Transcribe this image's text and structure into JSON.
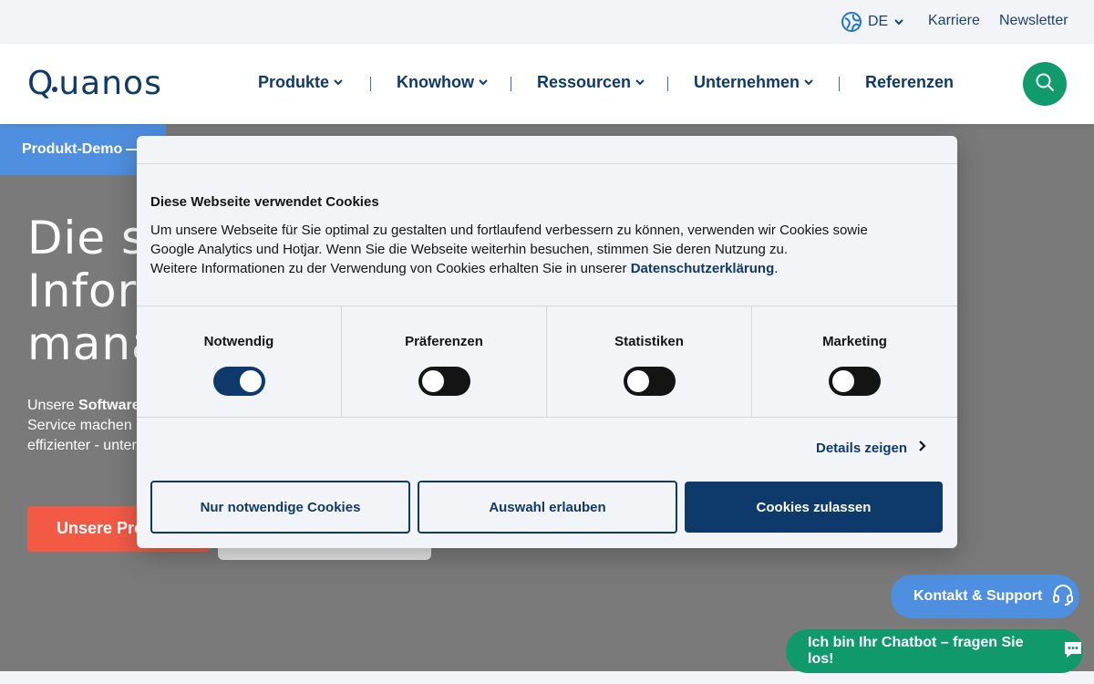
{
  "topbar": {
    "language": "DE",
    "links": [
      "Karriere",
      "Newsletter"
    ]
  },
  "header": {
    "logo": "Quanos",
    "nav": [
      {
        "label": "Produkte",
        "dropdown": true
      },
      {
        "label": "Knowhow",
        "dropdown": true
      },
      {
        "label": "Ressourcen",
        "dropdown": true
      },
      {
        "label": "Unternehmen",
        "dropdown": true
      },
      {
        "label": "Referenzen",
        "dropdown": false
      }
    ]
  },
  "hero": {
    "demo_tab": "Produkt-Demo",
    "title_lines": [
      "Die s",
      "Infor",
      "mana"
    ],
    "subtitle_prefix": "Unsere ",
    "subtitle_bold": "Software",
    "subtitle_line2": "Service machen I",
    "subtitle_line3": "effizienter - unters",
    "cta": "Unsere Pro"
  },
  "cookie": {
    "title": "Diese Webseite verwendet Cookies",
    "text_line1": "Um unsere Webseite für Sie optimal zu gestalten und fortlaufend verbessern zu können, verwenden wir Cookies sowie",
    "text_line2": "Google Analytics und Hotjar. Wenn Sie die Webseite weiterhin besuchen, stimmen Sie deren Nutzung zu.",
    "text_line3_prefix": "Weitere Informationen zu der Verwendung von Cookies erhalten Sie in unserer ",
    "privacy_link": "Datenschutzerklärung",
    "text_line3_suffix": ".",
    "categories": [
      {
        "label": "Notwendig",
        "enabled": true
      },
      {
        "label": "Präferenzen",
        "enabled": false
      },
      {
        "label": "Statistiken",
        "enabled": false
      },
      {
        "label": "Marketing",
        "enabled": false
      }
    ],
    "details_label": "Details zeigen",
    "btn_necessary": "Nur notwendige Cookies",
    "btn_selection": "Auswahl erlauben",
    "btn_allow_all": "Cookies zulassen"
  },
  "floating": {
    "support": "Kontakt & Support",
    "chatbot": "Ich bin Ihr Chatbot – fragen Sie los!"
  },
  "colors": {
    "brand_navy": "#0e3a6b",
    "search_green": "#119a6b",
    "demo_blue": "#4f8fe0",
    "cta_red": "#f25a45"
  }
}
